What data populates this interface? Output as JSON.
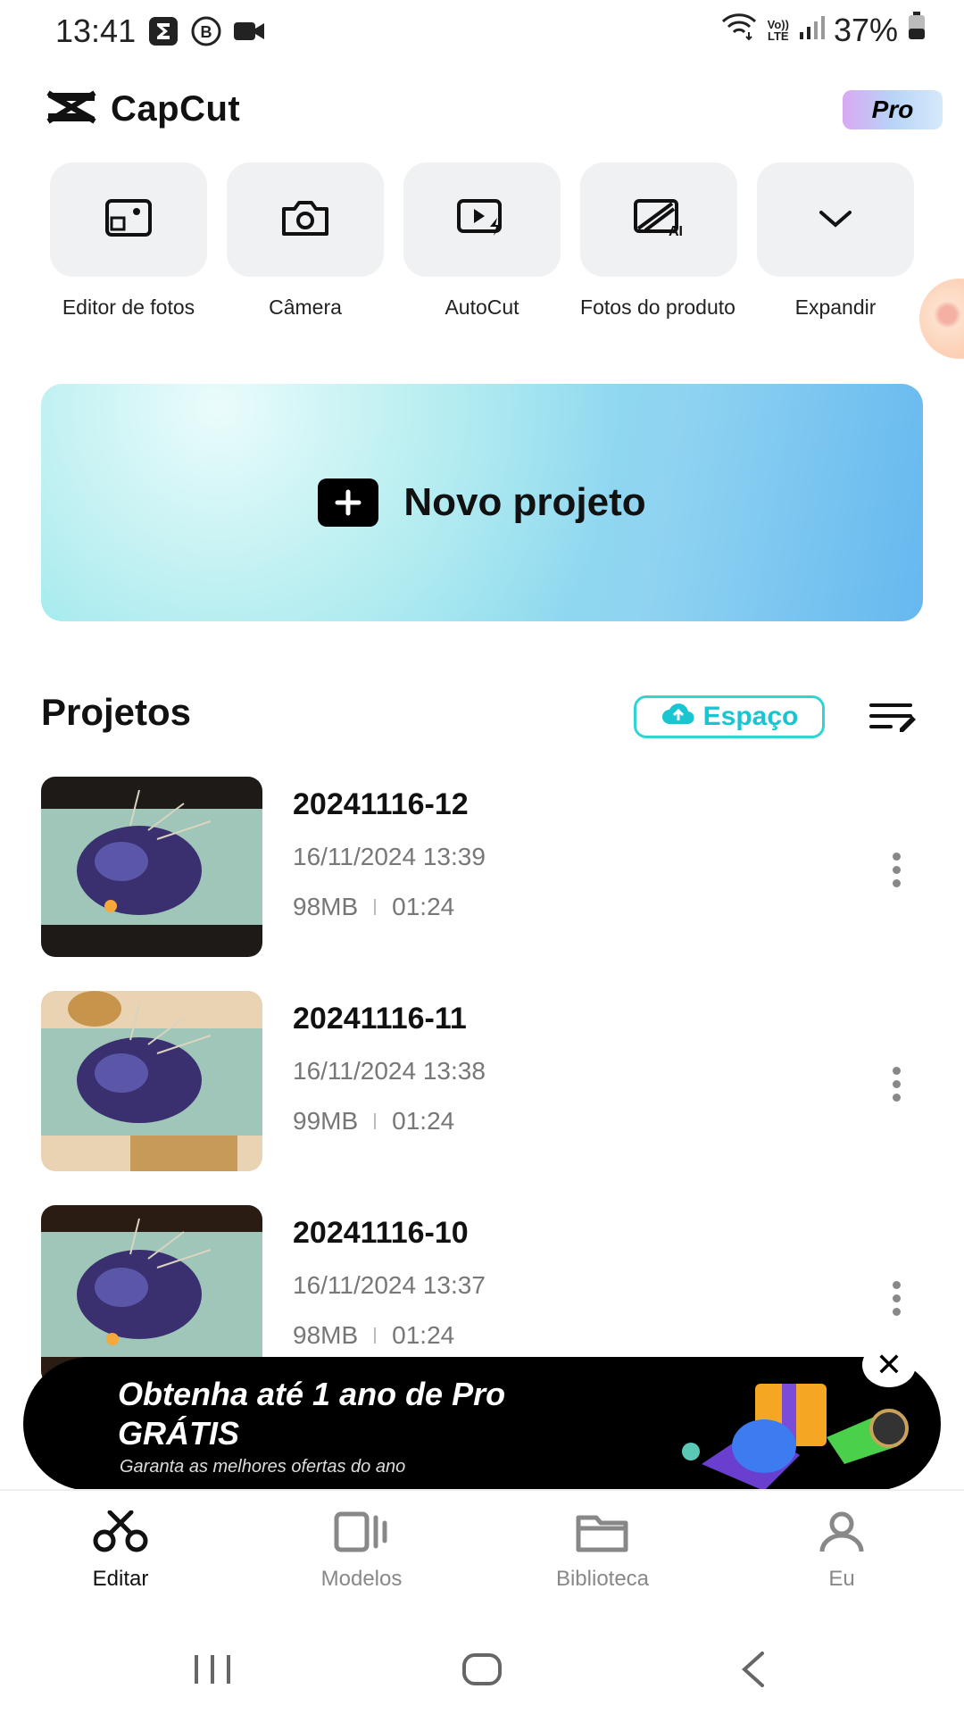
{
  "status_bar": {
    "time": "13:41",
    "battery": "37%",
    "lte_label": "VoLTE"
  },
  "header": {
    "app_name": "CapCut",
    "pro_label": "Pro"
  },
  "tools": [
    {
      "label": "Editor de fotos",
      "icon": "photo-editor-icon"
    },
    {
      "label": "Câmera",
      "icon": "camera-icon"
    },
    {
      "label": "AutoCut",
      "icon": "autocut-icon"
    },
    {
      "label": "Fotos do produto",
      "icon": "product-photo-ai-icon"
    },
    {
      "label": "Expandir",
      "icon": "chevron-down-icon"
    }
  ],
  "new_project": {
    "label": "Novo projeto"
  },
  "projects": {
    "title": "Projetos",
    "space_label": "Espaço",
    "items": [
      {
        "name": "20241116-12",
        "date": "16/11/2024 13:39",
        "size": "98MB",
        "duration": "01:24"
      },
      {
        "name": "20241116-11",
        "date": "16/11/2024 13:38",
        "size": "99MB",
        "duration": "01:24"
      },
      {
        "name": "20241116-10",
        "date": "16/11/2024 13:37",
        "size": "98MB",
        "duration": "01:24"
      }
    ]
  },
  "promo": {
    "title_line1": "Obtenha até 1 ano de Pro",
    "title_line2": "GRÁTIS",
    "subtitle": "Garanta as melhores ofertas do ano"
  },
  "bottom_nav": [
    {
      "label": "Editar",
      "icon": "scissors-icon",
      "active": true
    },
    {
      "label": "Modelos",
      "icon": "templates-icon",
      "active": false
    },
    {
      "label": "Biblioteca",
      "icon": "folder-icon",
      "active": false
    },
    {
      "label": "Eu",
      "icon": "user-icon",
      "active": false
    }
  ],
  "colors": {
    "accent": "#2fd5d5",
    "banner_start": "#7fe4e9",
    "banner_end": "#66b8f0"
  }
}
